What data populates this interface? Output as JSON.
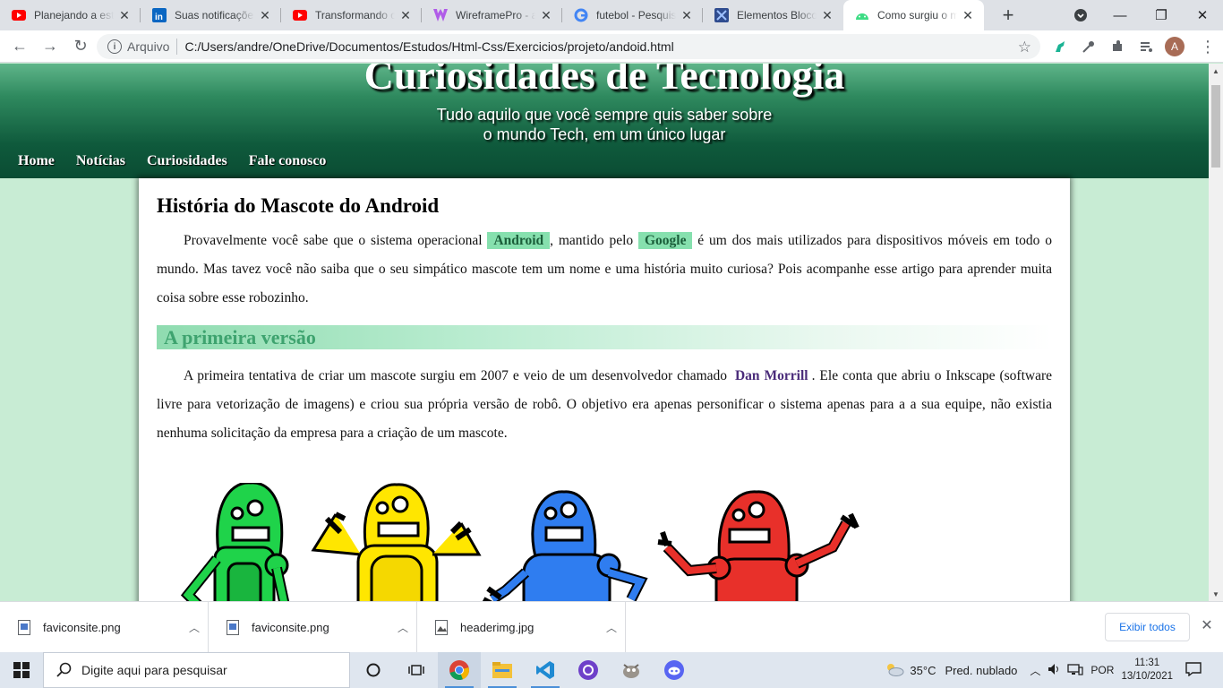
{
  "browser": {
    "tabs": [
      {
        "title": "Planejando a estrutura",
        "icon": "youtube-icon",
        "active": false
      },
      {
        "title": "Suas notificações",
        "icon": "linkedin-icon",
        "active": false
      },
      {
        "title": "Transformando o",
        "icon": "youtube-icon",
        "active": false
      },
      {
        "title": "WireframePro - a",
        "icon": "wireframepro-icon",
        "active": false
      },
      {
        "title": "futebol - Pesquisa",
        "icon": "google-icon",
        "active": false
      },
      {
        "title": "Elementos Bloco",
        "icon": "site-icon",
        "active": false
      },
      {
        "title": "Como surgiu o mascote",
        "icon": "android-icon",
        "active": true
      }
    ],
    "address": {
      "scheme_label": "Arquivo",
      "url": "C:/Users/andre/OneDrive/Documentos/Estudos/Html-Css/Exercicios/projeto/andoid.html"
    },
    "avatar_letter": "A"
  },
  "site": {
    "title": "Curiosidades de Tecnologia",
    "subtitle_line1": "Tudo aquilo que você sempre quis saber sobre",
    "subtitle_line2": "o mundo Tech, em um único lugar",
    "nav": [
      "Home",
      "Notícias",
      "Curiosidades",
      "Fale conosco"
    ]
  },
  "article": {
    "heading": "História do Mascote do Android",
    "p1": {
      "a": "Provavelmente você sabe que o sistema operacional ",
      "android": "Android",
      "b": ", mantido pelo ",
      "google": "Google",
      "c": " é um dos mais utilizados para dispositivos móveis em todo o mundo. Mas tavez você não saiba que o seu simpático mascote tem um nome e uma história muito curiosa? Pois acompanhe esse artigo para aprender muita coisa sobre esse robozinho."
    },
    "section_heading": "A primeira versão",
    "p2": {
      "a": "A primeira tentativa de criar um mascote surgiu em 2007 e veio de um desenvolvedor chamado ",
      "author": "Dan Morrill",
      "b": ". Ele conta que abriu o Inkscape (software livre para vetorização de imagens) e criou sua própria versão de robô. O objetivo era apenas personificar o sistema apenas para a a sua equipe, não existia nenhuma solicitação da empresa para a criação de um mascote."
    },
    "mascot_colors": [
      "#1fd34a",
      "#ffe600",
      "#2f7df0",
      "#e8302a"
    ]
  },
  "downloads": {
    "items": [
      "faviconsite.png",
      "faviconsite.png",
      "headerimg.jpg"
    ],
    "show_all": "Exibir todos"
  },
  "taskbar": {
    "search_placeholder": "Digite aqui para pesquisar",
    "weather_temp": "35°C",
    "weather_desc": "Pred. nublado",
    "language": "POR",
    "time": "11:31",
    "date": "13/10/2021"
  }
}
